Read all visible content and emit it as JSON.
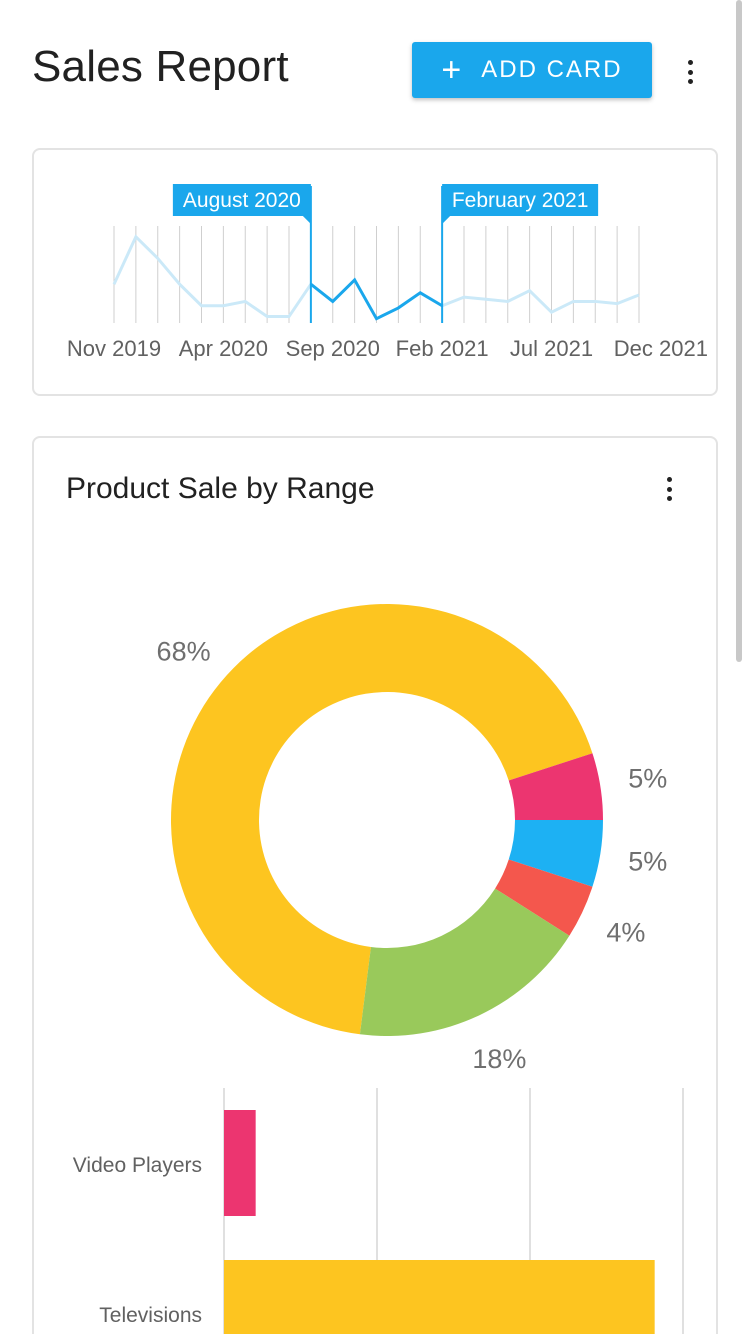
{
  "header": {
    "title": "Sales Report",
    "add_button_label": "ADD CARD",
    "add_button_icon": "plus-icon",
    "menu_icon": "more-vert-icon"
  },
  "range_selector": {
    "start_label": "August 2020",
    "end_label": "February 2021",
    "x_ticks": [
      "Nov 2019",
      "Apr 2020",
      "Sep 2020",
      "Feb 2021",
      "Jul 2021",
      "Dec 2021"
    ],
    "accent_color": "#1aa7ec",
    "chart_data": {
      "type": "line",
      "x_start": "Nov 2019",
      "x_end": "Dec 2021",
      "values": [
        18,
        40,
        30,
        18,
        8,
        8,
        10,
        3,
        3,
        18,
        10,
        20,
        2,
        7,
        14,
        8,
        12,
        11,
        10,
        15,
        5,
        10,
        10,
        9,
        13
      ],
      "ylim": [
        0,
        45
      ],
      "selection": [
        "August 2020",
        "February 2021"
      ]
    }
  },
  "product_card": {
    "title": "Product Sale by Range",
    "menu_icon": "more-vert-icon"
  },
  "chart_data": [
    {
      "type": "pie",
      "donut": true,
      "labels": [
        "68%",
        "5%",
        "5%",
        "4%",
        "18%"
      ],
      "values": [
        68,
        5,
        5,
        4,
        18
      ],
      "colors": [
        "#fdc520",
        "#ec3570",
        "#1db1f3",
        "#f4574d",
        "#99c95b"
      ]
    },
    {
      "type": "bar",
      "orientation": "horizontal",
      "categories": [
        "Video Players",
        "Televisions"
      ],
      "values": [
        5,
        68
      ],
      "colors": [
        "#ec3570",
        "#fdc520"
      ],
      "xlim": [
        0,
        72
      ]
    }
  ]
}
